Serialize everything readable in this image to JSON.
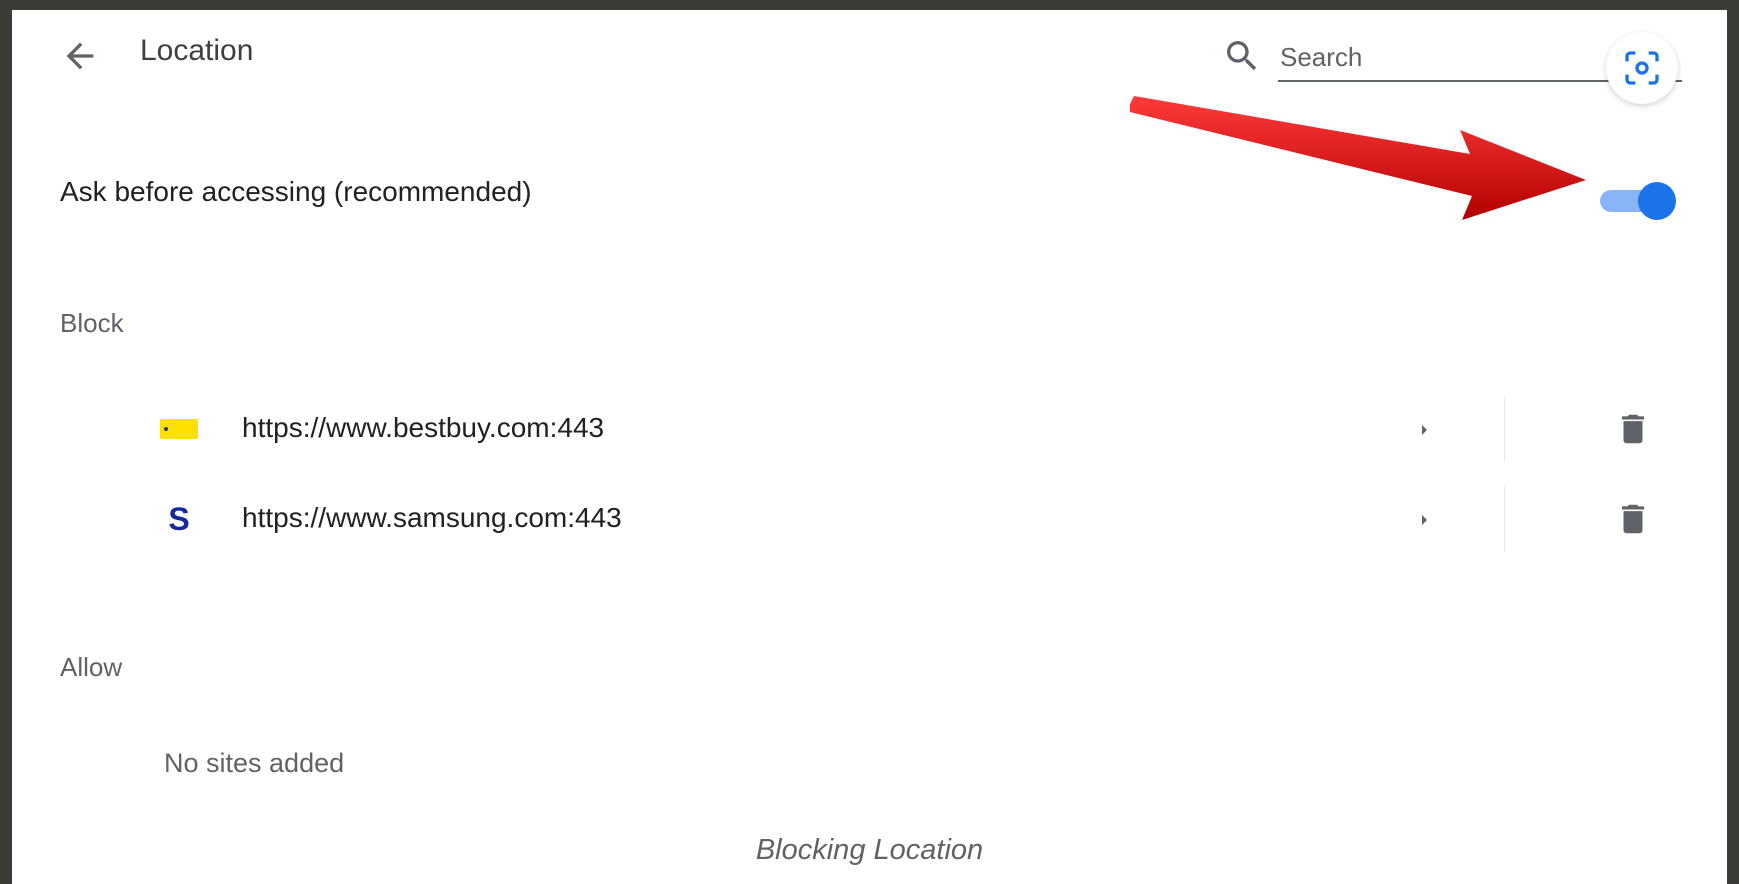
{
  "header": {
    "title": "Location",
    "search_placeholder": "Search"
  },
  "setting": {
    "ask_label": "Ask before accessing (recommended)",
    "toggle_on": true
  },
  "block": {
    "heading": "Block",
    "sites": [
      {
        "url": "https://www.bestbuy.com:443",
        "favicon": "bestbuy-favicon"
      },
      {
        "url": "https://www.samsung.com:443",
        "favicon": "samsung-favicon",
        "favicon_text": "S"
      }
    ]
  },
  "allow": {
    "heading": "Allow",
    "empty_text": "No sites added"
  },
  "caption": "Blocking Location",
  "colors": {
    "accent": "#1a73e8",
    "track": "#8ab4f8",
    "annotation_arrow": "#d8141a"
  }
}
